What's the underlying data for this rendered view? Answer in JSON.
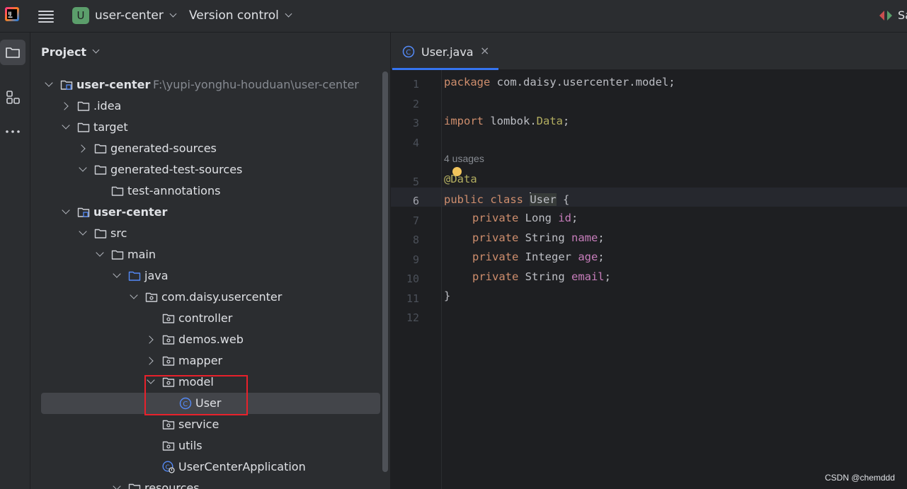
{
  "titlebar": {
    "project_badge": "U",
    "project_name": "user-center",
    "vcs_label": "Version control",
    "right_text": "Sa"
  },
  "panel": {
    "title": "Project"
  },
  "tree": [
    {
      "label": "user-center",
      "path": "F:\\yupi-yonghu-houduan\\user-center",
      "bold": true,
      "icon": "module-folder-icon",
      "expanded": true
    },
    {
      "label": ".idea",
      "icon": "folder-icon",
      "expanded": false
    },
    {
      "label": "target",
      "icon": "folder-icon",
      "expanded": true
    },
    {
      "label": "generated-sources",
      "icon": "folder-icon",
      "expanded": false
    },
    {
      "label": "generated-test-sources",
      "icon": "folder-icon",
      "expanded": true
    },
    {
      "label": "test-annotations",
      "icon": "folder-icon"
    },
    {
      "label": "user-center",
      "bold": true,
      "icon": "module-folder-icon",
      "expanded": true
    },
    {
      "label": "src",
      "icon": "folder-icon",
      "expanded": true
    },
    {
      "label": "main",
      "icon": "folder-icon",
      "expanded": true
    },
    {
      "label": "java",
      "icon": "source-folder-icon",
      "expanded": true
    },
    {
      "label": "com.daisy.usercenter",
      "icon": "package-icon",
      "expanded": true
    },
    {
      "label": "controller",
      "icon": "package-icon"
    },
    {
      "label": "demos.web",
      "icon": "package-icon",
      "expanded": false
    },
    {
      "label": "mapper",
      "icon": "package-icon",
      "expanded": false
    },
    {
      "label": "model",
      "icon": "package-icon",
      "expanded": true
    },
    {
      "label": "User",
      "icon": "class-icon",
      "selected": true
    },
    {
      "label": "service",
      "icon": "package-icon"
    },
    {
      "label": "utils",
      "icon": "package-icon"
    },
    {
      "label": "UserCenterApplication",
      "icon": "spring-class-icon"
    },
    {
      "label": "resources",
      "icon": "folder-icon",
      "expanded": true
    }
  ],
  "editor": {
    "tab_label": "User.java",
    "tab_close": "×",
    "usages_hint": "4 usages",
    "line_numbers": [
      "1",
      "2",
      "3",
      "4",
      "5",
      "6",
      "7",
      "8",
      "9",
      "10",
      "11",
      "12"
    ],
    "current_line": 6,
    "code": {
      "l1_kw": "package",
      "l1_rest": " com.daisy.usercenter.model;",
      "l3_kw": "import",
      "l3_rest": " lombok.",
      "l3_cls": "Data",
      "l3_end": ";",
      "l5_at": "@",
      "l5_ann": "Data",
      "l6_kw": "public class",
      "l6_space": " ",
      "l6_name": "User",
      "l6_end": " {",
      "fields": [
        {
          "kw": "private",
          "type": " Long ",
          "name": "id",
          "end": ";"
        },
        {
          "kw": "private",
          "type": " String ",
          "name": "name",
          "end": ";"
        },
        {
          "kw": "private",
          "type": " Integer ",
          "name": "age",
          "end": ";"
        },
        {
          "kw": "private",
          "type": " String ",
          "name": "email",
          "end": ";"
        }
      ],
      "l11": "}"
    }
  },
  "watermark": "CSDN @chemddd",
  "colors": {
    "accent": "#3574f0",
    "highlight_box": "#e8212b",
    "keyword": "#cf8e6d",
    "annotation": "#b3ae60",
    "field": "#c77dbb"
  }
}
